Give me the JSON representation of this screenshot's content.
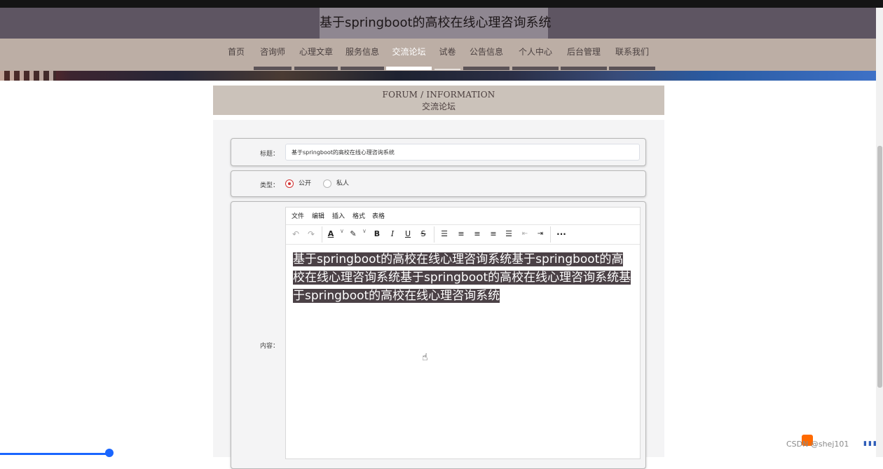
{
  "site": {
    "title": "基于springboot的高校在线心理咨询系统"
  },
  "nav": {
    "items": [
      {
        "label": "首页"
      },
      {
        "label": "咨询师"
      },
      {
        "label": "心理文章"
      },
      {
        "label": "服务信息"
      },
      {
        "label": "交流论坛",
        "active": true
      },
      {
        "label": "试卷"
      },
      {
        "label": "公告信息"
      },
      {
        "label": "个人中心"
      },
      {
        "label": "后台管理"
      },
      {
        "label": "联系我们"
      }
    ]
  },
  "section": {
    "title_en": "FORUM / INFORMATION",
    "title_cn": "交流论坛"
  },
  "form": {
    "title_label": "标题：",
    "title_value": "基于springboot的高校在线心理咨询系统",
    "type_label": "类型：",
    "type_options": [
      {
        "label": "公开",
        "checked": true
      },
      {
        "label": "私人",
        "checked": false
      }
    ],
    "content_label": "内容："
  },
  "editor": {
    "menu": [
      "文件",
      "编辑",
      "插入",
      "格式",
      "表格"
    ],
    "toolbar_icons": [
      "undo-icon",
      "redo-icon",
      "font-color-icon",
      "highlight-icon",
      "bold-icon",
      "italic-icon",
      "underline-icon",
      "strikethrough-icon",
      "line-height-icon",
      "align-left-icon",
      "align-center-icon",
      "align-right-icon",
      "align-justify-icon",
      "outdent-icon",
      "indent-icon",
      "more-icon"
    ],
    "content": "基于springboot的高校在线心理咨询系统基于springboot的高校在线心理咨询系统基于springboot的高校在线心理咨询系统基于springboot的高校在线心理咨询系统"
  },
  "watermark": {
    "text": "CSDN @shej101"
  },
  "colors": {
    "accent": "#d03333",
    "header": "#5e5562",
    "nav": "#bcaea5",
    "section_head": "#cbc2ba"
  }
}
